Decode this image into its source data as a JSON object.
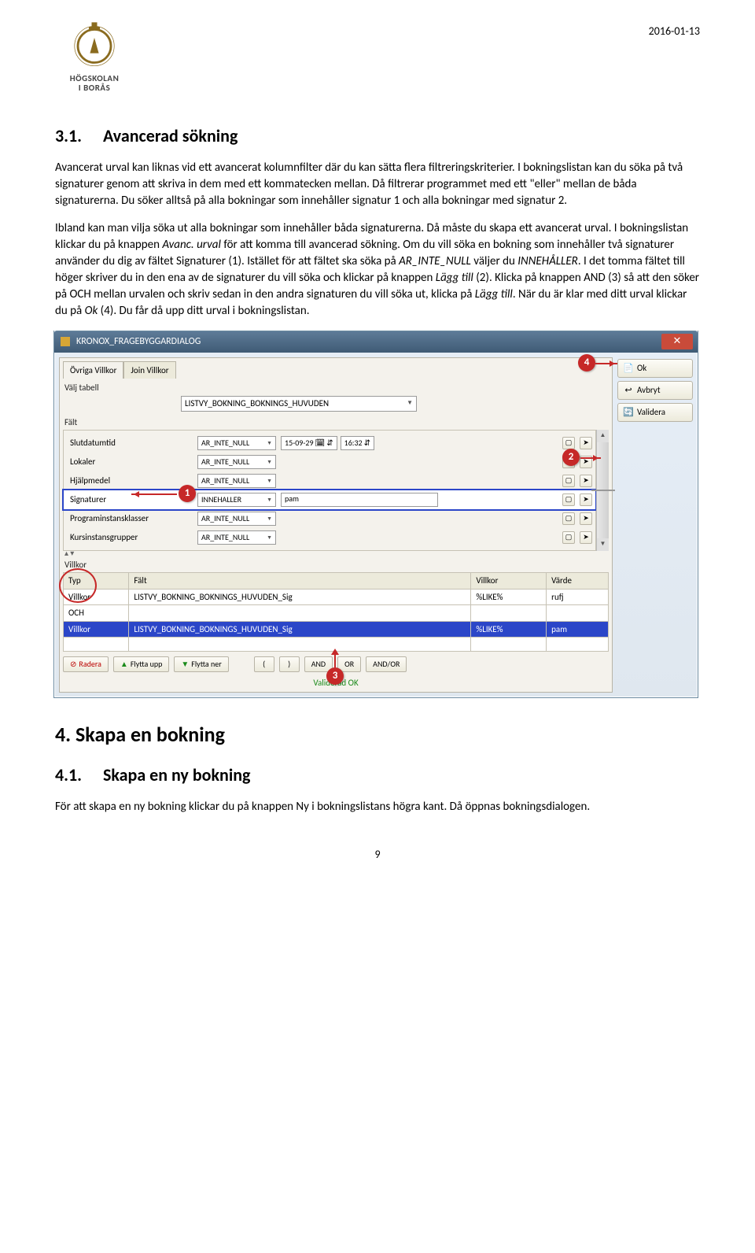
{
  "header": {
    "logo_line1": "HÖGSKOLAN",
    "logo_line2": "I BORÅS",
    "date": "2016-01-13"
  },
  "sec31": {
    "num": "3.1.",
    "title": "Avancerad sökning",
    "p1": "Avancerat urval kan liknas vid ett avancerat kolumnfilter där du kan sätta flera filtreringskriterier. I bokningslistan kan du söka på två signaturer genom att skriva in dem med ett kommatecken mellan. Då filtrerar programmet med ett \"eller\" mellan de båda signaturerna. Du söker alltså på alla bokningar som innehåller signatur 1 och alla bokningar med signatur 2.",
    "p2a": "Ibland kan man vilja söka ut alla bokningar som innehåller båda signaturerna. Då måste du skapa ett avancerat urval. I bokningslistan klickar du på knappen ",
    "p2i1": "Avanc. urval",
    "p2b": " för att komma till avancerad sökning. Om du vill söka en bokning som innehåller två signaturer använder du dig av fältet Signaturer (1). Istället för att fältet ska söka på ",
    "p2i2": "AR_INTE_NULL",
    "p2c": " väljer du ",
    "p2i3": "INNEHÅLLER",
    "p2d": ". I det tomma fältet till höger skriver du in den ena av de signaturer du vill söka och klickar på knappen ",
    "p2i4": "Lägg till",
    "p2e": " (2). Klicka på knappen AND (3) så att den söker på OCH mellan urvalen och skriv sedan in den andra signaturen du vill söka ut, klicka på ",
    "p2i5": "Lägg till",
    "p2f": ". När du är klar med ditt urval klickar du på ",
    "p2i6": "Ok",
    "p2g": " (4). Du får då upp ditt urval i bokningslistan."
  },
  "dialog": {
    "title": "KRONOX_FRAGEBYGGARDIALOG",
    "tabs": {
      "t1": "Övriga Villkor",
      "t2": "Join Villkor"
    },
    "valj_tabell": "Välj tabell",
    "tabell_value": "LISTVY_BOKNING_BOKNINGS_HUVUDEN",
    "falt_label": "Fält",
    "rows": {
      "r1": {
        "name": "Slutdatumtid",
        "op": "AR_INTE_NULL",
        "date": "15-09-29",
        "time": "16:32"
      },
      "r2": {
        "name": "Lokaler",
        "op": "AR_INTE_NULL"
      },
      "r3": {
        "name": "Hjälpmedel",
        "op": "AR_INTE_NULL"
      },
      "r4": {
        "name": "Signaturer",
        "op": "INNEHALLER",
        "val": "pam"
      },
      "r5": {
        "name": "Programinstansklasser",
        "op": "AR_INTE_NULL"
      },
      "r6": {
        "name": "Kursinstansgrupper",
        "op": "AR_INTE_NULL"
      }
    },
    "villkor_label": "Villkor",
    "vheaders": {
      "c1": "Typ",
      "c2": "Fält",
      "c3": "Villkor",
      "c4": "Värde"
    },
    "vrows": {
      "r1": {
        "typ": "Villkor",
        "falt": "LISTVY_BOKNING_BOKNINGS_HUVUDEN_Sig",
        "villkor": "%LIKE%",
        "varde": "rufj"
      },
      "r2": {
        "typ": "OCH",
        "falt": "",
        "villkor": "",
        "varde": ""
      },
      "r3": {
        "typ": "Villkor",
        "falt": "LISTVY_BOKNING_BOKNINGS_HUVUDEN_Sig",
        "villkor": "%LIKE%",
        "varde": "pam"
      }
    },
    "btns": {
      "radera": "Radera",
      "flyttaupp": "Flytta upp",
      "flyttaner": "Flytta ner",
      "lp": "(",
      "rp": ")",
      "and": "AND",
      "or": "OR",
      "andor": "AND/OR"
    },
    "validated": "Validerad OK",
    "right": {
      "ok": "Ok",
      "avbryt": "Avbryt",
      "validera": "Validera"
    },
    "markers": {
      "m1": "1",
      "m2": "2",
      "m3": "3",
      "m4": "4"
    }
  },
  "sec4": {
    "h1": "4. Skapa en bokning",
    "h2num": "4.1.",
    "h2title": "Skapa en ny bokning",
    "p": "För att skapa en ny bokning klickar du på knappen Ny i bokningslistans högra kant. Då öppnas bokningsdialogen."
  },
  "pagenum": "9"
}
